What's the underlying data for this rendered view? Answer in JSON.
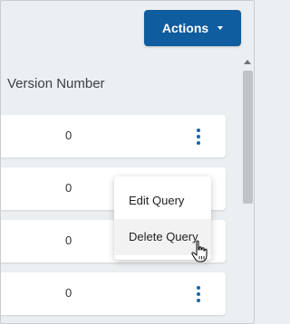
{
  "toolbar": {
    "actions_label": "Actions"
  },
  "table": {
    "column_header": "Version Number",
    "rows": [
      {
        "version": "0"
      },
      {
        "version": "0"
      },
      {
        "version": "0"
      },
      {
        "version": "0"
      }
    ]
  },
  "context_menu": {
    "items": [
      {
        "label": "Edit Query"
      },
      {
        "label": "Delete Query"
      }
    ]
  },
  "colors": {
    "primary": "#0f5c9e",
    "kebab": "#1467a8",
    "background": "#eceff1"
  },
  "icons": {
    "row_menu": "kebab-vertical-icon",
    "dropdown": "caret-down-icon",
    "cursor": "hand-pointer-icon"
  }
}
